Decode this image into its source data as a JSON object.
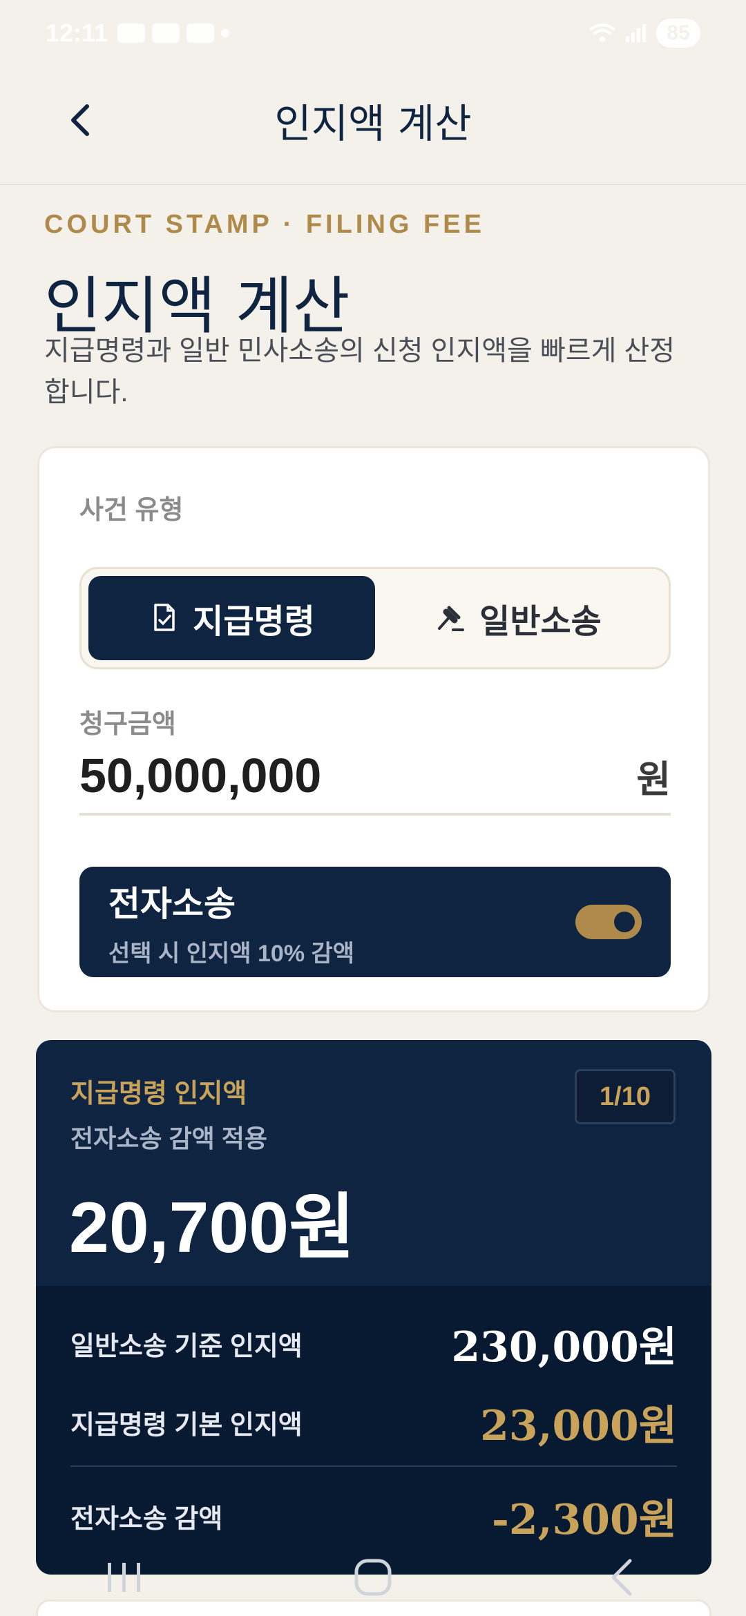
{
  "status_bar": {
    "time": "12:11",
    "battery": "85"
  },
  "app_bar": {
    "title": "인지액 계산"
  },
  "header": {
    "eyebrow": "COURT STAMP · FILING FEE",
    "title": "인지액 계산",
    "subtitle": "지급명령과 일반 민사소송의 신청 인지액을 빠르게 산정합니다."
  },
  "form": {
    "case_type_label": "사건 유형",
    "case_types": [
      {
        "label": "지급명령",
        "icon": "document-check-icon",
        "selected": true
      },
      {
        "label": "일반소송",
        "icon": "gavel-icon",
        "selected": false
      }
    ],
    "amount_label": "청구금액",
    "amount_value": "50,000,000",
    "amount_unit": "원",
    "e_litigation": {
      "title": "전자소송",
      "description": "선택 시 인지액 10% 감액",
      "enabled": true
    }
  },
  "result": {
    "eyebrow": "지급명령 인지액",
    "note": "전자소송 감액 적용",
    "amount": "20,700원",
    "ratio_badge": "1/10",
    "rows": [
      {
        "label": "일반소송 기준 인지액",
        "value": "230,000",
        "unit": "원"
      },
      {
        "label": "지급명령 기본 인지액",
        "value": "23,000",
        "unit": "원"
      },
      {
        "label": "전자소송 감액",
        "value": "-2,300",
        "unit": "원"
      }
    ]
  },
  "colors": {
    "navy": "#0f2440",
    "gold": "#b08a4a",
    "background": "#f4f0ea"
  }
}
